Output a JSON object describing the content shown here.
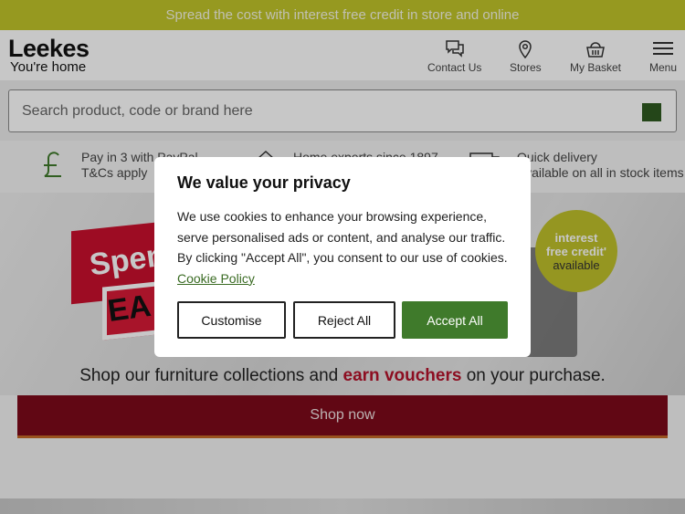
{
  "promo_bar": {
    "text": "Spread the cost with interest free credit in store and online"
  },
  "header": {
    "logo_main": "Leekes",
    "logo_sub": "You're home",
    "nav": [
      {
        "label": "Contact Us",
        "icon": "chat-icon"
      },
      {
        "label": "Stores",
        "icon": "location-pin-icon"
      },
      {
        "label": "My Basket",
        "icon": "basket-icon"
      },
      {
        "label": "Menu",
        "icon": "hamburger-icon"
      }
    ]
  },
  "search": {
    "placeholder": "Search product, code or brand here",
    "value": ""
  },
  "usps": [
    {
      "line1": "Pay in 3 with PayPal",
      "line2": "T&Cs apply",
      "icon": "pound-icon"
    },
    {
      "line1": "Home experts since 1897",
      "line2": "",
      "icon": "home-icon"
    },
    {
      "line1": "Quick delivery",
      "line2": "Available on all in stock items",
      "icon": "truck-icon"
    }
  ],
  "hero": {
    "spend_text": "Spen",
    "earn_text": "EA",
    "credit_line1": "interest",
    "credit_line2": "free credit'",
    "credit_line3": "available",
    "caption_before": "Shop our furniture collections and ",
    "caption_highlight": "earn vouchers",
    "caption_after": " on your purchase."
  },
  "shop_button": {
    "label": "Shop now"
  },
  "cookie_modal": {
    "title": "We value your privacy",
    "body": "We use cookies to enhance your browsing experience, serve personalised ads or content, and analyse our traffic. By clicking \"Accept All\", you consent to our use of cookies. ",
    "link": "Cookie Policy",
    "customise_label": "Customise",
    "reject_label": "Reject All",
    "accept_label": "Accept All"
  },
  "colors": {
    "promo": "#c1c42a",
    "accept": "#3f7a2b",
    "shop_button": "#7d0a1a",
    "highlight": "#b5122b"
  }
}
